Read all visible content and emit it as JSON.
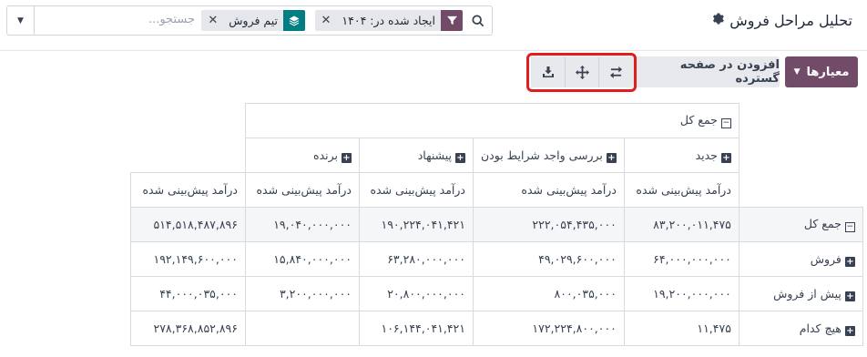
{
  "header": {
    "title": "تحلیل مراحل فروش",
    "settings_icon": "gear-icon"
  },
  "search": {
    "placeholder": "جستجو...",
    "facets": [
      {
        "icon": "filter-icon",
        "label": "ایجاد شده در: ۱۴۰۴",
        "color": "#714b67"
      },
      {
        "icon": "layers-icon",
        "label": "تیم فروش",
        "color": "#017e84"
      }
    ]
  },
  "toolbar": {
    "criteria_label": "معیارها",
    "add_to_spreadsheet_label": "افزودن در صفحه گسترده",
    "icons": [
      "flip-axis-icon",
      "expand-all-icon",
      "download-icon"
    ],
    "accent_color": "#714b67"
  },
  "pivot": {
    "total_header": "جمع کل",
    "columns": [
      "جدید",
      "بررسی واجد شرایط بودن",
      "پیشنهاد",
      "برنده"
    ],
    "measure": "درآمد پیش‌بینی شده",
    "rows": [
      {
        "label": "جمع کل",
        "values": [
          "۸۳,۲۰۰,۰۱۱,۴۷۵",
          "۲۲۲,۰۵۴,۴۳۵,۰۰۰",
          "۱۹۰,۲۲۴,۰۴۱,۴۲۱",
          "۱۹,۰۴۰,۰۰۰,۰۰۰"
        ],
        "total": "۵۱۴,۵۱۸,۴۸۷,۸۹۶"
      },
      {
        "label": "فروش",
        "values": [
          "۶۴,۰۰۰,۰۰۰,۰۰۰",
          "۴۹,۰۲۹,۶۰۰,۰۰۰",
          "۶۳,۲۸۰,۰۰۰,۰۰۰",
          "۱۵,۸۴۰,۰۰۰,۰۰۰"
        ],
        "total": "۱۹۲,۱۴۹,۶۰۰,۰۰۰"
      },
      {
        "label": "پیش از فروش",
        "values": [
          "۱۹,۲۰۰,۰۰۰,۰۰۰",
          "۸۰۰,۰۳۵,۰۰۰",
          "۲۰,۸۰۰,۰۰۰,۰۰۰",
          "۳,۲۰۰,۰۰۰,۰۰۰"
        ],
        "total": "۴۴,۰۰۰,۰۳۵,۰۰۰"
      },
      {
        "label": "هیچ کدام",
        "values": [
          "۱۱,۴۷۵",
          "۱۷۲,۲۲۴,۸۰۰,۰۰۰",
          "۱۰۶,۱۴۴,۰۴۱,۴۲۱",
          ""
        ],
        "total": "۲۷۸,۳۶۸,۸۵۲,۸۹۶"
      }
    ]
  }
}
